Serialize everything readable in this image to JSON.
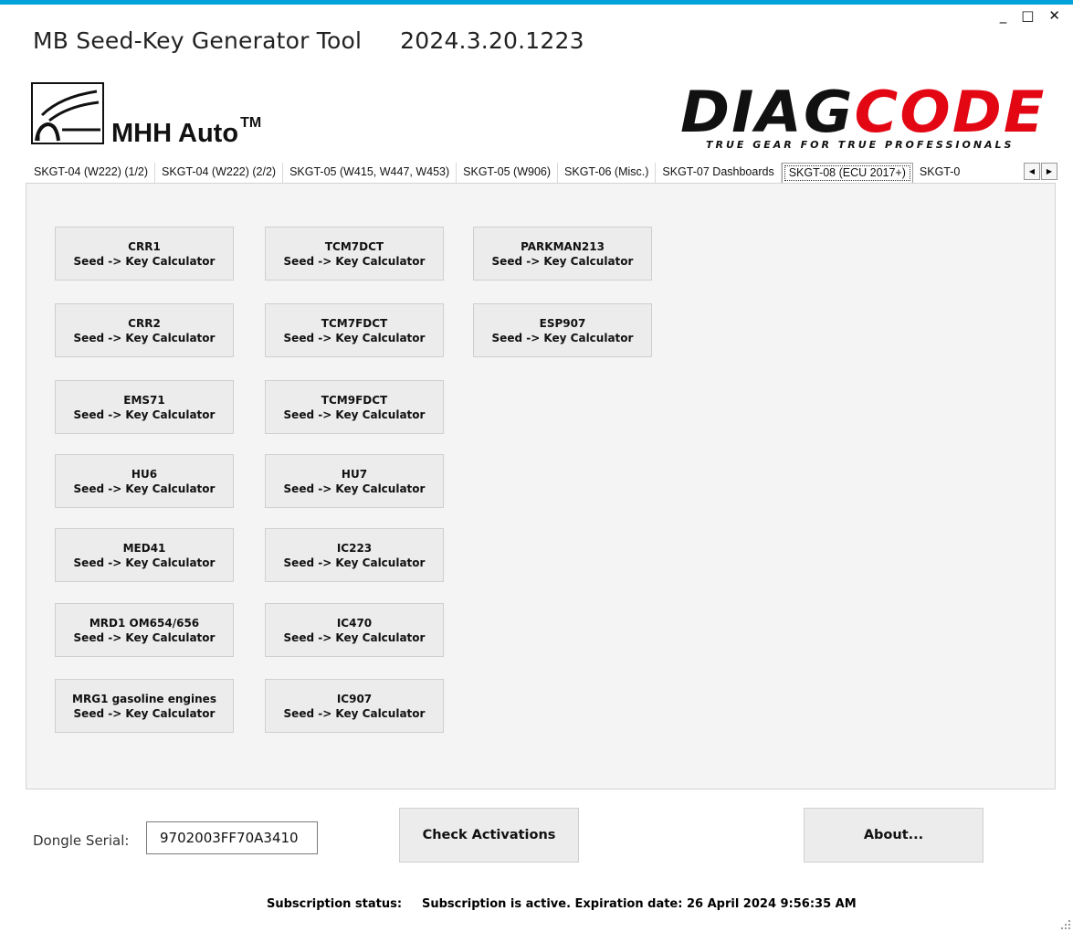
{
  "window": {
    "title": "MB Seed-Key Generator Tool",
    "version": "2024.3.20.1223",
    "controls": {
      "minimize": "_",
      "maximize": "□",
      "close": "✕"
    },
    "accent_color": "#00a3d9"
  },
  "logos": {
    "mhh": {
      "text": "MHH Auto",
      "tm": "TM"
    },
    "diagcode": {
      "word_dark": "DIAG",
      "word_red": "CODE",
      "tagline": "TRUE GEAR FOR TRUE PROFESSIONALS",
      "accent": "#e30613"
    }
  },
  "tabs": [
    {
      "label": "SKGT-04 (W222) (1/2)",
      "active": false
    },
    {
      "label": "SKGT-04 (W222) (2/2)",
      "active": false
    },
    {
      "label": "SKGT-05 (W415, W447, W453)",
      "active": false
    },
    {
      "label": "SKGT-05 (W906)",
      "active": false
    },
    {
      "label": "SKGT-06 (Misc.)",
      "active": false
    },
    {
      "label": "SKGT-07 Dashboards",
      "active": false
    },
    {
      "label": "SKGT-08 (ECU 2017+)",
      "active": true
    },
    {
      "label": "SKGT-0",
      "active": false
    }
  ],
  "tab_scroll": {
    "left": "◀",
    "right": "▶"
  },
  "calculators": [
    {
      "name": "CRR1",
      "sub": "Seed -> Key Calculator"
    },
    {
      "name": "CRR2",
      "sub": "Seed -> Key Calculator"
    },
    {
      "name": "EMS71",
      "sub": "Seed -> Key Calculator"
    },
    {
      "name": "HU6",
      "sub": "Seed -> Key Calculator"
    },
    {
      "name": "MED41",
      "sub": "Seed -> Key Calculator"
    },
    {
      "name": "MRD1 OM654/656",
      "sub": "Seed -> Key Calculator"
    },
    {
      "name": "MRG1 gasoline engines",
      "sub": "Seed -> Key Calculator"
    },
    {
      "name": "TCM7DCT",
      "sub": "Seed -> Key Calculator"
    },
    {
      "name": "TCM7FDCT",
      "sub": "Seed -> Key Calculator"
    },
    {
      "name": "TCM9FDCT",
      "sub": "Seed -> Key Calculator"
    },
    {
      "name": "HU7",
      "sub": "Seed -> Key Calculator"
    },
    {
      "name": "IC223",
      "sub": "Seed -> Key Calculator"
    },
    {
      "name": "IC470",
      "sub": "Seed -> Key Calculator"
    },
    {
      "name": "IC907",
      "sub": "Seed -> Key Calculator"
    },
    {
      "name": "PARKMAN213",
      "sub": "Seed -> Key Calculator"
    },
    {
      "name": "ESP907",
      "sub": "Seed -> Key Calculator"
    }
  ],
  "footer": {
    "dongle_label": "Dongle Serial:",
    "dongle_value": "9702003FF70A3410",
    "check_button": "Check Activations",
    "about_button": "About...",
    "status_label": "Subscription status:",
    "status_text": "Subscription is active.  Expiration date: 26 April 2024 9:56:35 AM"
  }
}
